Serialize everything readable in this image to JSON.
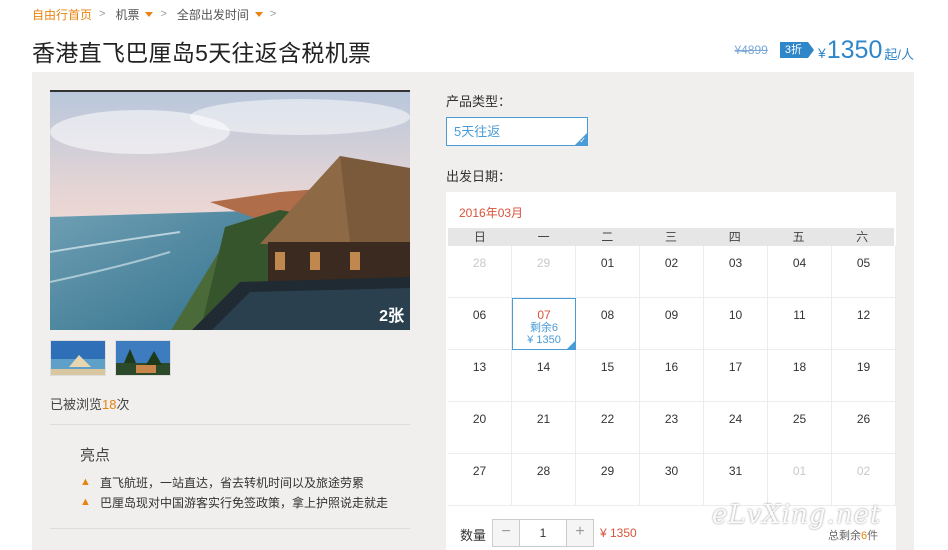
{
  "breadcrumb": {
    "home": "自由行首页",
    "category": "机票",
    "filter": "全部出发时间"
  },
  "title": "香港直飞巴厘岛5天往返含税机票",
  "price": {
    "original": "¥4899",
    "discount": "3折",
    "currency": "¥",
    "current": "1350",
    "unit": "起/人"
  },
  "gallery": {
    "photo_count": "2张"
  },
  "views": {
    "prefix": "已被浏览",
    "count": "18",
    "suffix": "次"
  },
  "highlights": {
    "title": "亮点",
    "items": [
      "直飞航班，一站直达，省去转机时间以及旅途劳累",
      "巴厘岛现对中国游客实行免签政策，拿上护照说走就走"
    ]
  },
  "product_type": {
    "label": "产品类型：",
    "value": "5天往返"
  },
  "departure": {
    "label": "出发日期："
  },
  "calendar": {
    "month": "2016年03月",
    "weekdays": [
      "日",
      "一",
      "二",
      "三",
      "四",
      "五",
      "六"
    ],
    "days": [
      {
        "d": "28",
        "muted": true
      },
      {
        "d": "29",
        "muted": true
      },
      {
        "d": "01"
      },
      {
        "d": "02"
      },
      {
        "d": "03"
      },
      {
        "d": "04"
      },
      {
        "d": "05"
      },
      {
        "d": "06"
      },
      {
        "d": "07",
        "active": true,
        "stock": "剩余6",
        "price": "¥ 1350"
      },
      {
        "d": "08"
      },
      {
        "d": "09"
      },
      {
        "d": "10"
      },
      {
        "d": "11"
      },
      {
        "d": "12"
      },
      {
        "d": "13"
      },
      {
        "d": "14"
      },
      {
        "d": "15"
      },
      {
        "d": "16"
      },
      {
        "d": "17"
      },
      {
        "d": "18"
      },
      {
        "d": "19"
      },
      {
        "d": "20"
      },
      {
        "d": "21"
      },
      {
        "d": "22"
      },
      {
        "d": "23"
      },
      {
        "d": "24"
      },
      {
        "d": "25"
      },
      {
        "d": "26"
      },
      {
        "d": "27"
      },
      {
        "d": "28"
      },
      {
        "d": "29"
      },
      {
        "d": "30"
      },
      {
        "d": "31"
      },
      {
        "d": "01",
        "muted": true
      },
      {
        "d": "02",
        "muted": true
      }
    ]
  },
  "quantity": {
    "label": "数量",
    "minus": "−",
    "value": "1",
    "plus": "+",
    "price": "¥ 1350",
    "stock_prefix": "总剩余",
    "stock_count": "6",
    "stock_suffix": "件"
  },
  "watermark": "eLvXing.net",
  "colors": {
    "accent_orange": "#e8830f",
    "accent_blue": "#2f86c9",
    "price_red": "#d9533a"
  }
}
